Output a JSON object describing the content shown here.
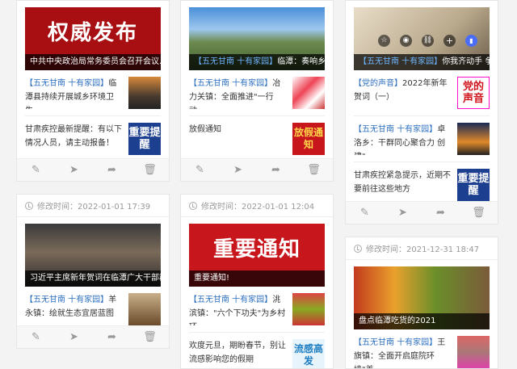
{
  "icons": {
    "edit": "✎",
    "send": "➤",
    "share": "➦",
    "delete": "🗑",
    "star": "☆",
    "eye": "◉",
    "link": "⛓",
    "plus": "+",
    "bookmark": "▮"
  },
  "card1": {
    "cover_title": "权威发布",
    "cover_caption": "中共中央政治局常务委员会召开会议…",
    "items": [
      {
        "tag": "【五无甘南 十有家园】",
        "text": "临潭县持续开展城乡环境卫生…"
      },
      {
        "text": "甘肃疾控最新提醒：有以下情况人员，请主动报备！",
        "thumb": "重要提醒"
      }
    ]
  },
  "card2": {
    "cover_tag": "【五无甘南 十有家园】",
    "cover_caption": "临潭：奏响乡…",
    "items": [
      {
        "tag": "【五无甘南 十有家园】",
        "text": "冶力关镇：全面推进\"一行动…"
      },
      {
        "text": "放假通知",
        "thumb": "放假通知"
      }
    ]
  },
  "card3": {
    "cover_tag": "【五无甘南 十有家园】",
    "cover_caption": "你我齐动手 争…",
    "items": [
      {
        "tag": "【党的声音】",
        "text": "2022年新年贺词（一）",
        "thumb": "党的声音"
      },
      {
        "tag": "【五无甘南 十有家园】",
        "text": "卓洛乡：干群同心聚合力 创建\"…"
      },
      {
        "text": "甘肃疾控紧急提示，近期不要前往这些地方",
        "thumb": "重要提醒"
      }
    ]
  },
  "card4": {
    "modified": "修改时间：2022-01-01 17:39",
    "cover_caption": "习近平主席新年贺词在临潭广大干部群…",
    "items": [
      {
        "tag": "【五无甘南 十有家园】",
        "text": "羊永镇：绘就生态宜居蓝图"
      }
    ]
  },
  "card5": {
    "modified": "修改时间：2022-01-01 12:04",
    "cover_title": "重要通知",
    "cover_caption": "重要通知!",
    "items": [
      {
        "tag": "【五无甘南 十有家园】",
        "text": "洮滨镇：\"六个下功夫\"为乡村环…"
      },
      {
        "text": "欢度元旦，期盼春节，别让流感影响您的假期",
        "thumb": "流感高发"
      }
    ]
  },
  "card6": {
    "modified": "修改时间：2021-12-31 18:47",
    "cover_caption": "盘点临潭吃货的2021",
    "items": [
      {
        "tag": "【五无甘南 十有家园】",
        "text": "王旗镇：全面开启庭院环境\"美…"
      }
    ]
  }
}
